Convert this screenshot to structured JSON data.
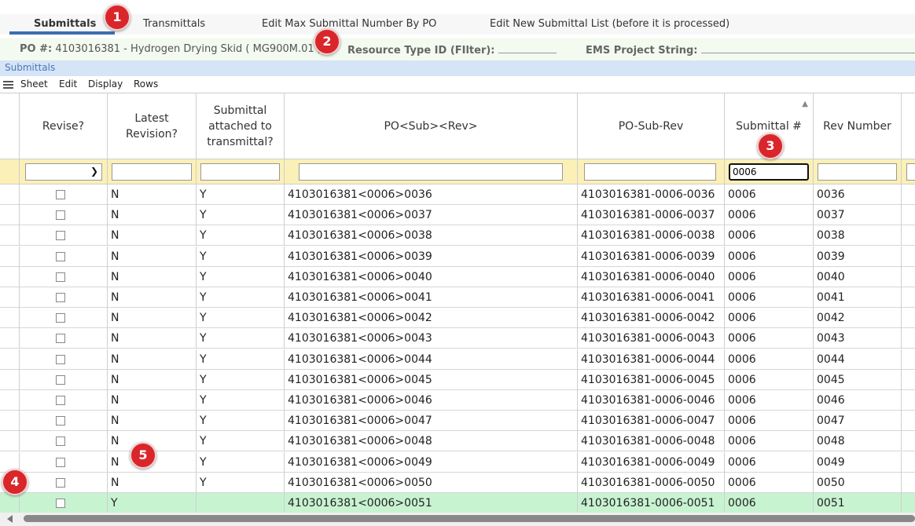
{
  "tabs": [
    {
      "label": "Submittals"
    },
    {
      "label": "Transmittals"
    },
    {
      "label": "Edit Max Submittal Number By PO"
    },
    {
      "label": "Edit New Submittal List (before it is processed)"
    }
  ],
  "po_bar": {
    "po_label": "PO #:",
    "po_value": "4103016381 - Hydrogen Drying Skid ( MG900M.01 )",
    "resource_label": "Resource Type ID (FIlter):",
    "ems_label": "EMS Project String:"
  },
  "section_title": "Submittals",
  "menu": [
    "Sheet",
    "Edit",
    "Display",
    "Rows"
  ],
  "columns": [
    {
      "header": "Revise?"
    },
    {
      "header": "Latest Revision?"
    },
    {
      "header": "Submittal attached to transmittal?"
    },
    {
      "header": "PO<Sub><Rev>"
    },
    {
      "header": "PO-Sub-Rev"
    },
    {
      "header": "Submittal #"
    },
    {
      "header": "Rev Number"
    }
  ],
  "filters": {
    "submittal_no": "0006"
  },
  "rows": [
    {
      "latest": "N",
      "attached": "Y",
      "po_sub_rev": "4103016381<0006>0036",
      "po_dash": "4103016381-0006-0036",
      "sub_no": "0006",
      "rev": "0036"
    },
    {
      "latest": "N",
      "attached": "Y",
      "po_sub_rev": "4103016381<0006>0037",
      "po_dash": "4103016381-0006-0037",
      "sub_no": "0006",
      "rev": "0037"
    },
    {
      "latest": "N",
      "attached": "Y",
      "po_sub_rev": "4103016381<0006>0038",
      "po_dash": "4103016381-0006-0038",
      "sub_no": "0006",
      "rev": "0038"
    },
    {
      "latest": "N",
      "attached": "Y",
      "po_sub_rev": "4103016381<0006>0039",
      "po_dash": "4103016381-0006-0039",
      "sub_no": "0006",
      "rev": "0039"
    },
    {
      "latest": "N",
      "attached": "Y",
      "po_sub_rev": "4103016381<0006>0040",
      "po_dash": "4103016381-0006-0040",
      "sub_no": "0006",
      "rev": "0040"
    },
    {
      "latest": "N",
      "attached": "Y",
      "po_sub_rev": "4103016381<0006>0041",
      "po_dash": "4103016381-0006-0041",
      "sub_no": "0006",
      "rev": "0041"
    },
    {
      "latest": "N",
      "attached": "Y",
      "po_sub_rev": "4103016381<0006>0042",
      "po_dash": "4103016381-0006-0042",
      "sub_no": "0006",
      "rev": "0042"
    },
    {
      "latest": "N",
      "attached": "Y",
      "po_sub_rev": "4103016381<0006>0043",
      "po_dash": "4103016381-0006-0043",
      "sub_no": "0006",
      "rev": "0043"
    },
    {
      "latest": "N",
      "attached": "Y",
      "po_sub_rev": "4103016381<0006>0044",
      "po_dash": "4103016381-0006-0044",
      "sub_no": "0006",
      "rev": "0044"
    },
    {
      "latest": "N",
      "attached": "Y",
      "po_sub_rev": "4103016381<0006>0045",
      "po_dash": "4103016381-0006-0045",
      "sub_no": "0006",
      "rev": "0045"
    },
    {
      "latest": "N",
      "attached": "Y",
      "po_sub_rev": "4103016381<0006>0046",
      "po_dash": "4103016381-0006-0046",
      "sub_no": "0006",
      "rev": "0046"
    },
    {
      "latest": "N",
      "attached": "Y",
      "po_sub_rev": "4103016381<0006>0047",
      "po_dash": "4103016381-0006-0047",
      "sub_no": "0006",
      "rev": "0047"
    },
    {
      "latest": "N",
      "attached": "Y",
      "po_sub_rev": "4103016381<0006>0048",
      "po_dash": "4103016381-0006-0048",
      "sub_no": "0006",
      "rev": "0048"
    },
    {
      "latest": "N",
      "attached": "Y",
      "po_sub_rev": "4103016381<0006>0049",
      "po_dash": "4103016381-0006-0049",
      "sub_no": "0006",
      "rev": "0049"
    },
    {
      "latest": "N",
      "attached": "Y",
      "po_sub_rev": "4103016381<0006>0050",
      "po_dash": "4103016381-0006-0050",
      "sub_no": "0006",
      "rev": "0050"
    },
    {
      "latest": "Y",
      "attached": "",
      "po_sub_rev": "4103016381<0006>0051",
      "po_dash": "4103016381-0006-0051",
      "sub_no": "0006",
      "rev": "0051",
      "highlighted": true
    }
  ],
  "markers": [
    "1",
    "2",
    "3",
    "4",
    "5"
  ],
  "colors": {
    "marker": "#d9262a",
    "highlight_row": "#c8f3d1",
    "filter_row": "#fbf0b7",
    "tab_underline": "#3d6db0"
  }
}
